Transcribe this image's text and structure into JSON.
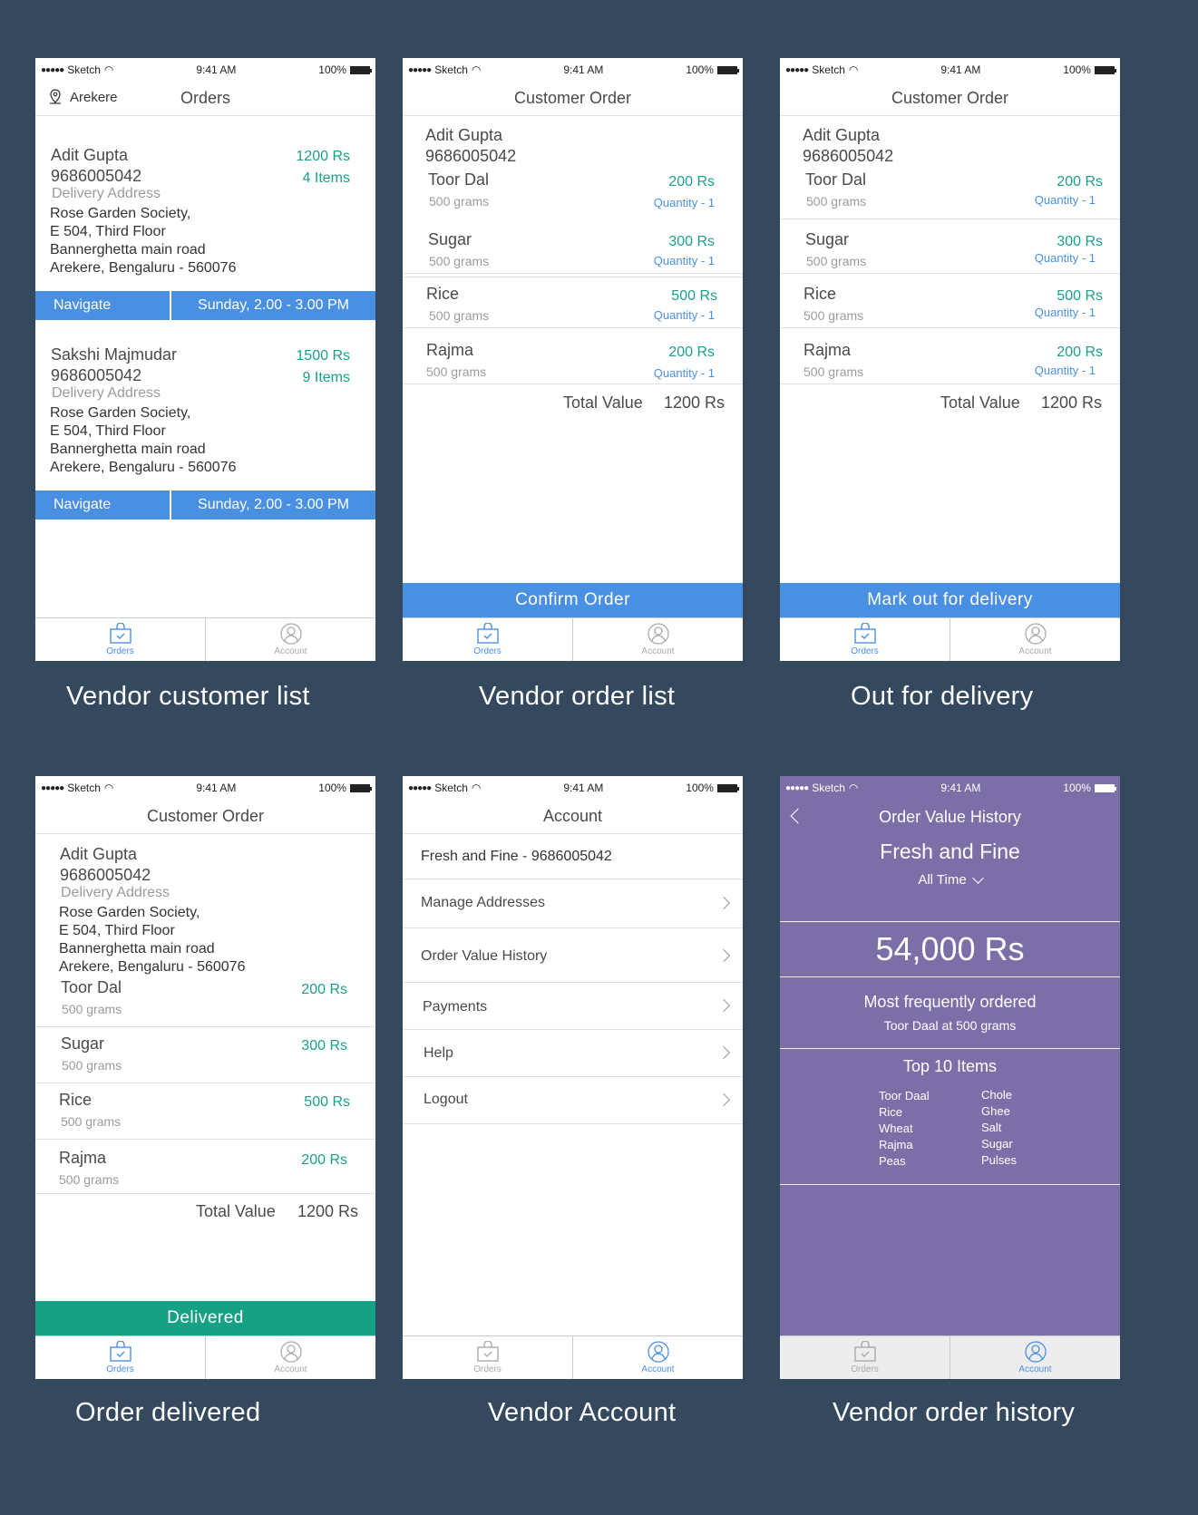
{
  "status": {
    "carrier": "Sketch",
    "time": "9:41 AM",
    "battery": "100%"
  },
  "tabs": {
    "orders": "Orders",
    "account": "Account"
  },
  "screen1": {
    "location": "Arekere",
    "title": "Orders",
    "customers": [
      {
        "name": "Adit Gupta",
        "phone": "9686005042",
        "price": "1200 Rs",
        "items": "4 Items",
        "address_label": "Delivery Address",
        "address": [
          "Rose Garden Society,",
          "E 504, Third Floor",
          "Bannerghetta main road",
          "Arekere, Bengaluru - 560076"
        ],
        "navigate": "Navigate",
        "slot": "Sunday, 2.00 - 3.00 PM"
      },
      {
        "name": "Sakshi Majmudar",
        "phone": "9686005042",
        "price": "1500 Rs",
        "items": "9 Items",
        "address_label": "Delivery Address",
        "address": [
          "Rose Garden Society,",
          "E 504, Third Floor",
          "Bannerghetta main road",
          "Arekere, Bengaluru - 560076"
        ],
        "navigate": "Navigate",
        "slot": "Sunday, 2.00 - 3.00 PM"
      }
    ],
    "caption": "Vendor customer list"
  },
  "screen2": {
    "title": "Customer Order",
    "name": "Adit Gupta",
    "phone": "9686005042",
    "items": [
      {
        "name": "Toor Dal",
        "weight": "500 grams",
        "price": "200 Rs",
        "qty": "Quantity - 1"
      },
      {
        "name": "Sugar",
        "weight": "500 grams",
        "price": "300 Rs",
        "qty": "Quantity - 1"
      },
      {
        "name": "Rice",
        "weight": "500 grams",
        "price": "500 Rs",
        "qty": "Quantity - 1"
      },
      {
        "name": "Rajma",
        "weight": "500 grams",
        "price": "200 Rs",
        "qty": "Quantity - 1"
      }
    ],
    "total_label": "Total Value",
    "total": "1200 Rs",
    "button": "Confirm Order",
    "caption": "Vendor order list"
  },
  "screen3": {
    "title": "Customer Order",
    "name": "Adit Gupta",
    "phone": "9686005042",
    "items": [
      {
        "name": "Toor Dal",
        "weight": "500 grams",
        "price": "200 Rs",
        "qty": "Quantity - 1"
      },
      {
        "name": "Sugar",
        "weight": "500 grams",
        "price": "300 Rs",
        "qty": "Quantity - 1"
      },
      {
        "name": "Rice",
        "weight": "500 grams",
        "price": "500 Rs",
        "qty": "Quantity - 1"
      },
      {
        "name": "Rajma",
        "weight": "500 grams",
        "price": "200 Rs",
        "qty": "Quantity - 1"
      }
    ],
    "total_label": "Total Value",
    "total": "1200 Rs",
    "button": "Mark out for delivery",
    "caption": "Out for delivery"
  },
  "screen4": {
    "title": "Customer Order",
    "name": "Adit Gupta",
    "phone": "9686005042",
    "address_label": "Delivery Address",
    "address": [
      "Rose Garden Society,",
      "E 504, Third Floor",
      "Bannerghetta main road",
      "Arekere, Bengaluru - 560076"
    ],
    "items": [
      {
        "name": "Toor Dal",
        "weight": "500 grams",
        "price": "200 Rs"
      },
      {
        "name": "Sugar",
        "weight": "500 grams",
        "price": "300 Rs"
      },
      {
        "name": "Rice",
        "weight": "500 grams",
        "price": "500 Rs"
      },
      {
        "name": "Rajma",
        "weight": "500 grams",
        "price": "200 Rs"
      }
    ],
    "total_label": "Total Value",
    "total": "1200 Rs",
    "button": "Delivered",
    "caption": "Order delivered"
  },
  "screen5": {
    "title": "Account",
    "vendor": "Fresh and Fine - 9686005042",
    "menu": [
      "Manage Addresses",
      "Order Value History",
      "Payments",
      "Help",
      "Logout"
    ],
    "caption": "Vendor Account"
  },
  "screen6": {
    "title": "Order Value History",
    "store": "Fresh and Fine",
    "filter": "All Time",
    "amount": "54,000 Rs",
    "freq_label": "Most frequently ordered",
    "freq_item": "Toor Daal at 500 grams",
    "top_label": "Top 10 Items",
    "top_left": [
      "Toor Daal",
      "Rice",
      "Wheat",
      "Rajma",
      "Peas"
    ],
    "top_right": [
      "Chole",
      "Ghee",
      "Salt",
      "Sugar",
      "Pulses"
    ],
    "caption": "Vendor order history"
  },
  "colors": {
    "background": "#34495e",
    "accent_blue": "#4a90e2",
    "price_teal": "#1a9f8c",
    "delivered_green": "#16a085",
    "history_purple": "#7c6fa8"
  }
}
